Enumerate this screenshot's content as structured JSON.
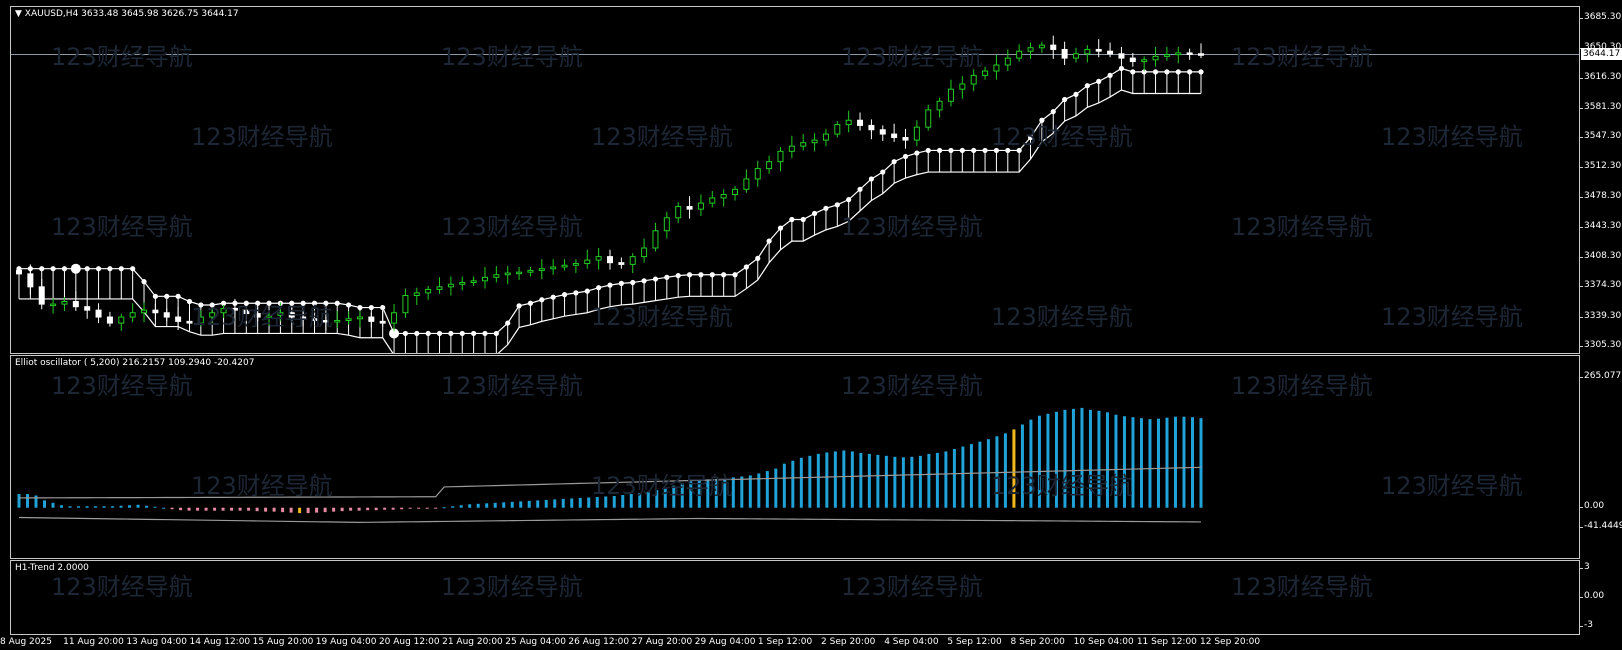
{
  "main": {
    "symbol_caption": "XAUUSD,H4  3633.48 3645.98 3626.75 3644.17",
    "current_price": "3644.17",
    "price_ticks": [
      "3685.30",
      "3650.30",
      "3616.30",
      "3581.30",
      "3547.30",
      "3512.30",
      "3478.30",
      "3443.30",
      "3408.30",
      "3374.30",
      "3339.30",
      "3305.30"
    ]
  },
  "oscillator": {
    "caption": "Elliot oscillator ( 5,200) 216.2157 109.2940 -20.4207",
    "ticks": [
      "265.077",
      "0.00",
      "-41.4449"
    ]
  },
  "trend": {
    "caption": "H1-Trend 2.0000",
    "ticks": [
      "3",
      "0.00",
      "-3"
    ]
  },
  "time_axis": [
    "8 Aug 2025",
    "11 Aug 20:00",
    "13 Aug 04:00",
    "14 Aug 12:00",
    "15 Aug 20:00",
    "19 Aug 04:00",
    "20 Aug 12:00",
    "21 Aug 20:00",
    "25 Aug 04:00",
    "26 Aug 12:00",
    "27 Aug 20:00",
    "29 Aug 04:00",
    "1 Sep 12:00",
    "2 Sep 20:00",
    "4 Sep 04:00",
    "5 Sep 12:00",
    "8 Sep 20:00",
    "10 Sep 04:00",
    "11 Sep 12:00",
    "12 Sep 20:00"
  ],
  "watermark": "123财经导航",
  "colors": {
    "bull": "#22cc22",
    "bear": "#ffffff",
    "osc_pos": "#1fa3d8",
    "osc_neg": "#e88aa4",
    "osc_hl": "#f2b81c"
  },
  "chart_data": {
    "type": "candlestick",
    "symbol": "XAUUSD",
    "timeframe": "H4",
    "ohlc_last": {
      "open": 3633.48,
      "high": 3645.98,
      "low": 3626.75,
      "close": 3644.17
    },
    "ylim": [
      3305.3,
      3685.3
    ],
    "price_path": [
      3390,
      3375,
      3355,
      3355,
      3358,
      3352,
      3348,
      3340,
      3333,
      3340,
      3345,
      3348,
      3345,
      3340,
      3335,
      3333,
      3340,
      3345,
      3350,
      3348,
      3344,
      3340,
      3342,
      3345,
      3340,
      3338,
      3336,
      3335,
      3336,
      3338,
      3340,
      3335,
      3333,
      3345,
      3365,
      3368,
      3372,
      3375,
      3378,
      3380,
      3382,
      3386,
      3389,
      3391,
      3392,
      3394,
      3396,
      3398,
      3400,
      3402,
      3406,
      3410,
      3403,
      3401,
      3410,
      3420,
      3440,
      3455,
      3468,
      3465,
      3472,
      3478,
      3482,
      3488,
      3500,
      3512,
      3520,
      3532,
      3538,
      3542,
      3545,
      3552,
      3563,
      3568,
      3562,
      3557,
      3552,
      3548,
      3545,
      3560,
      3580,
      3590,
      3604,
      3610,
      3620,
      3625,
      3632,
      3640,
      3648,
      3652,
      3655,
      3650,
      3640,
      3645,
      3650,
      3648,
      3645,
      3640,
      3636,
      3638,
      3642,
      3644,
      3646,
      3645,
      3644
    ],
    "osc_ylim": [
      -41.4449,
      265.077
    ],
    "osc_values": [
      28,
      28,
      25,
      15,
      10,
      5,
      3,
      3,
      3,
      3,
      3,
      3,
      4,
      5,
      6,
      4,
      2,
      0,
      -3,
      -5,
      -6,
      -6,
      -6,
      -6,
      -6,
      -6,
      -6,
      -6,
      -7,
      -8,
      -8,
      -9,
      -10,
      -11,
      -11,
      -10,
      -9,
      -8,
      -7,
      -6,
      -6,
      -5,
      -5,
      -4,
      -4,
      -3,
      -2,
      -1,
      -1,
      -1,
      1,
      3,
      5,
      7,
      8,
      9,
      10,
      11,
      12,
      13,
      14,
      15,
      16,
      17,
      18,
      19,
      20,
      21,
      22,
      23,
      24,
      26,
      28,
      30,
      32,
      36,
      40,
      45,
      50,
      54,
      56,
      58,
      59,
      60,
      62,
      64,
      66,
      70,
      75,
      80,
      90,
      96,
      102,
      106,
      110,
      113,
      115,
      117,
      115,
      112,
      110,
      108,
      106,
      104,
      103,
      104,
      106,
      110,
      112,
      115,
      120,
      125,
      130,
      135,
      140,
      146,
      152,
      160,
      170,
      180,
      188,
      192,
      196,
      200,
      202,
      204,
      200,
      198,
      195,
      190,
      187,
      185,
      183,
      181,
      182,
      184,
      186,
      186,
      185,
      183
    ],
    "osc_highlight_index": [
      33,
      117
    ],
    "trend_value": 2.0
  }
}
